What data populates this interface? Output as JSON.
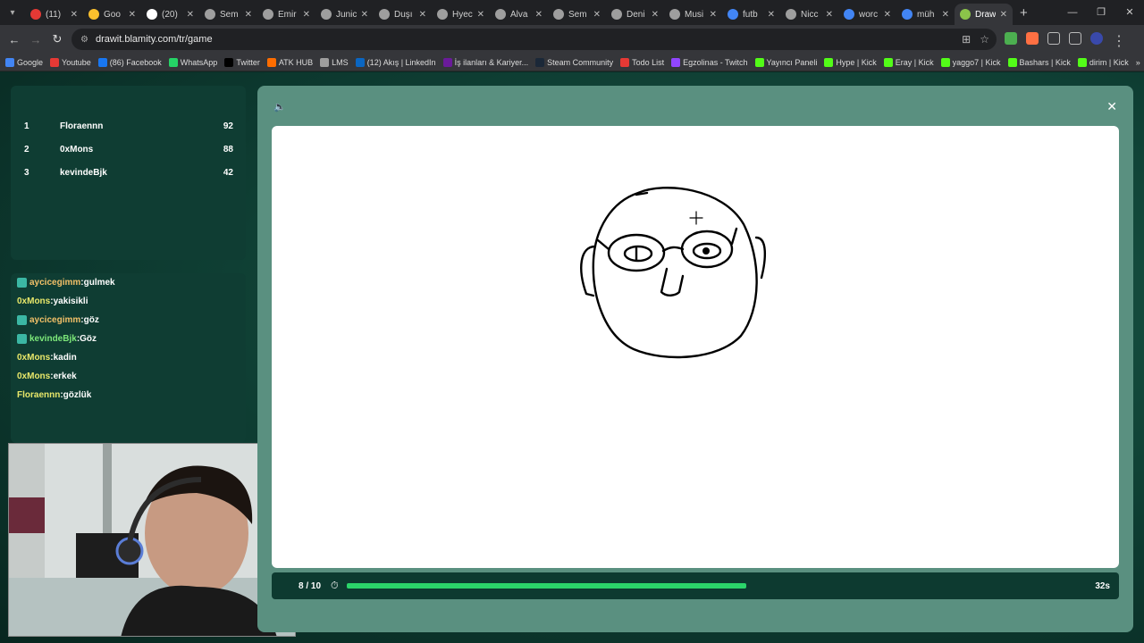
{
  "browser": {
    "tabs": [
      {
        "title": "(11)",
        "color": "#e53935"
      },
      {
        "title": "Goo",
        "color": "#fbc02d"
      },
      {
        "title": "(20)",
        "color": "#ffffff"
      },
      {
        "title": "Sem",
        "color": "#9e9e9e"
      },
      {
        "title": "Emir",
        "color": "#9e9e9e"
      },
      {
        "title": "Junic",
        "color": "#9e9e9e"
      },
      {
        "title": "Duşı",
        "color": "#9e9e9e"
      },
      {
        "title": "Hyec",
        "color": "#9e9e9e"
      },
      {
        "title": "Álva",
        "color": "#9e9e9e"
      },
      {
        "title": "Sem",
        "color": "#9e9e9e"
      },
      {
        "title": "Deni",
        "color": "#9e9e9e"
      },
      {
        "title": "Musi",
        "color": "#9e9e9e"
      },
      {
        "title": "futb",
        "color": "#4285f4"
      },
      {
        "title": "Nicc",
        "color": "#9e9e9e"
      },
      {
        "title": "worc",
        "color": "#4285f4"
      },
      {
        "title": "müh",
        "color": "#4285f4"
      },
      {
        "title": "Draw",
        "color": "#8bc34a",
        "active": true
      }
    ],
    "url": "drawit.blamity.com/tr/game",
    "bookmarks": [
      {
        "label": "Google",
        "color": "#4285f4"
      },
      {
        "label": "Youtube",
        "color": "#e53935"
      },
      {
        "label": "(86) Facebook",
        "color": "#1877f2"
      },
      {
        "label": "WhatsApp",
        "color": "#25d366"
      },
      {
        "label": "Twitter",
        "color": "#000000"
      },
      {
        "label": "ATK HUB",
        "color": "#ff6d00"
      },
      {
        "label": "LMS",
        "color": "#9e9e9e"
      },
      {
        "label": "(12) Akış | LinkedIn",
        "color": "#0a66c2"
      },
      {
        "label": "İş ilanları & Kariyer...",
        "color": "#6a1b9a"
      },
      {
        "label": "Steam Community",
        "color": "#1b2838"
      },
      {
        "label": "Todo List",
        "color": "#e53935"
      },
      {
        "label": "Egzolinas - Twitch",
        "color": "#9146ff"
      },
      {
        "label": "Yayıncı Paneli",
        "color": "#53fc18"
      },
      {
        "label": "Hype | Kick",
        "color": "#53fc18"
      },
      {
        "label": "Eray | Kick",
        "color": "#53fc18"
      },
      {
        "label": "yaggo7 | Kick",
        "color": "#53fc18"
      },
      {
        "label": "Bashars | Kick",
        "color": "#53fc18"
      },
      {
        "label": "dirim | Kick",
        "color": "#53fc18"
      }
    ]
  },
  "leaderboard": [
    {
      "rank": "1",
      "name": "Floraennn",
      "score": "92"
    },
    {
      "rank": "2",
      "name": "0xMons",
      "score": "88"
    },
    {
      "rank": "3",
      "name": "kevindeBjk",
      "score": "42"
    }
  ],
  "chat": [
    {
      "user": "ayciсegimm",
      "msg": ":gulmek",
      "badge": true,
      "style": "teal"
    },
    {
      "user": "0xMons",
      "msg": ":yakisikli",
      "badge": false,
      "style": "yellow"
    },
    {
      "user": "ayciсegimm",
      "msg": ":göz",
      "badge": true,
      "style": "teal"
    },
    {
      "user": "kevindeBjk",
      "msg": ":Göz",
      "badge": true,
      "style": "green"
    },
    {
      "user": "0xMons",
      "msg": ":kadin",
      "badge": false,
      "style": "yellow"
    },
    {
      "user": "0xMons",
      "msg": ":erkek",
      "badge": false,
      "style": "yellow"
    },
    {
      "user": "Floraennn",
      "msg": ":gözlük",
      "badge": false,
      "style": "yellow"
    }
  ],
  "game": {
    "round": "8 / 10",
    "progress_fraction": 0.54,
    "seconds_left": "32s",
    "accent": "#2bd46a"
  }
}
